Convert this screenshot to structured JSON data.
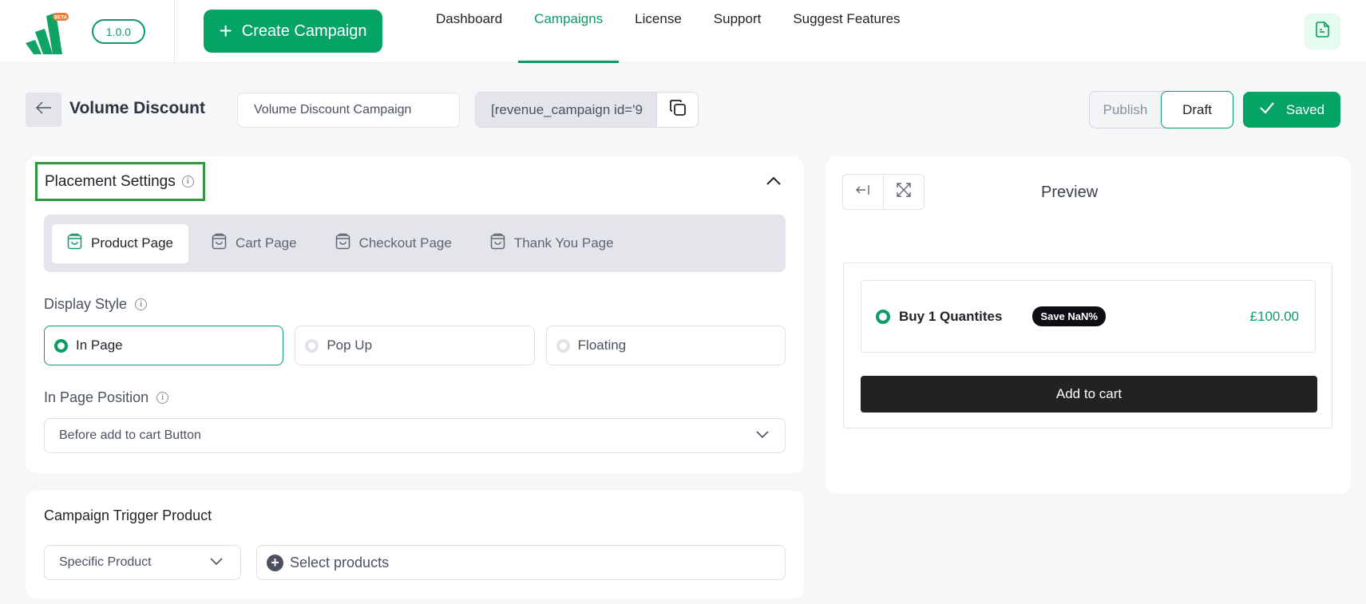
{
  "app": {
    "version": "1.0.0",
    "logo_badge": "BETA",
    "brand_color": "#05a366"
  },
  "topbar": {
    "create_label": "Create Campaign",
    "nav": [
      {
        "label": "Dashboard",
        "active": false
      },
      {
        "label": "Campaigns",
        "active": true
      },
      {
        "label": "License",
        "active": false
      },
      {
        "label": "Support",
        "active": false
      },
      {
        "label": "Suggest Features",
        "active": false
      }
    ],
    "doc_icon": "document-icon"
  },
  "header": {
    "title": "Volume Discount",
    "campaign_name_value": "Volume Discount Campaign",
    "shortcode_value": "[revenue_campaign id='9",
    "status_options": [
      "Publish",
      "Draft"
    ],
    "status_selected": "Draft",
    "saved_label": "Saved"
  },
  "placement": {
    "title": "Placement Settings",
    "page_tabs": [
      {
        "label": "Product Page",
        "active": true
      },
      {
        "label": "Cart Page",
        "active": false
      },
      {
        "label": "Checkout Page",
        "active": false
      },
      {
        "label": "Thank You Page",
        "active": false
      }
    ],
    "display_style_label": "Display Style",
    "display_styles": [
      {
        "label": "In Page",
        "selected": true
      },
      {
        "label": "Pop Up",
        "selected": false
      },
      {
        "label": "Floating",
        "selected": false
      }
    ],
    "position_label": "In Page Position",
    "position_value": "Before add to cart Button"
  },
  "trigger": {
    "title": "Campaign Trigger Product",
    "type_value": "Specific Product",
    "products_placeholder": "Select products"
  },
  "preview": {
    "title": "Preview",
    "offer": {
      "label": "Buy 1 Quantites",
      "badge": "Save NaN%",
      "price": "£100.00"
    },
    "add_to_cart_label": "Add to cart"
  }
}
